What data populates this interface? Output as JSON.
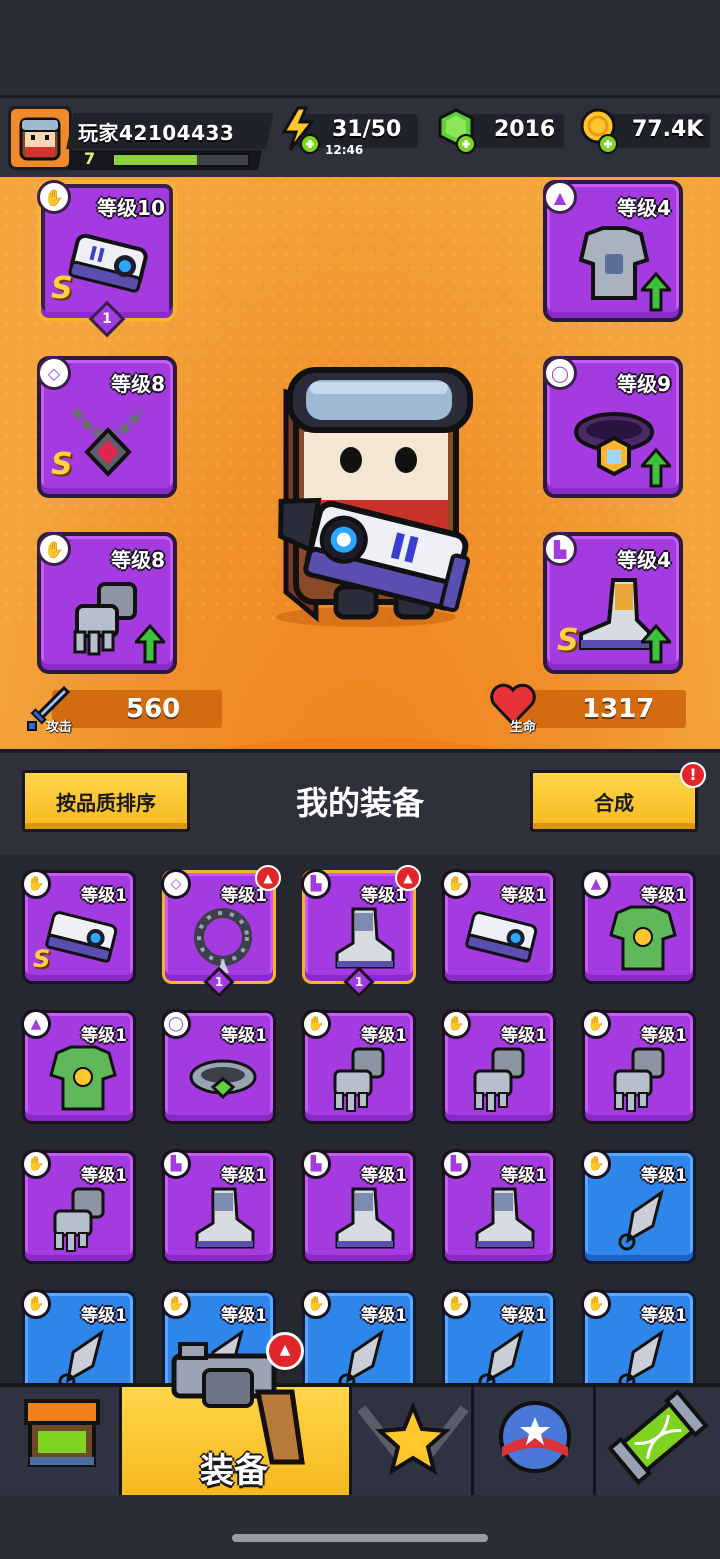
{
  "player": {
    "name": "玩家42104433",
    "level": "7",
    "xp_fraction": 0.62
  },
  "resources": {
    "energy": {
      "value": "31/50",
      "timer": "12:46",
      "icon": "lightning-icon"
    },
    "gems": {
      "value": "2016",
      "icon": "green-gem-icon"
    },
    "coins": {
      "value": "77.4K",
      "icon": "gold-coin-icon"
    }
  },
  "equipped": {
    "weapon": {
      "level": "等级10",
      "rank": "S",
      "stars": "1"
    },
    "armor": {
      "level": "等级4"
    },
    "necklace": {
      "level": "等级8",
      "rank": "S"
    },
    "ring": {
      "level": "等级9"
    },
    "gloves": {
      "level": "等级8"
    },
    "boots": {
      "level": "等级4",
      "rank": "S"
    }
  },
  "stats": {
    "attack": {
      "label": "攻击",
      "value": "560"
    },
    "hp": {
      "label": "生命",
      "value": "1317"
    }
  },
  "toolbar": {
    "sort_label": "按品质排序",
    "title": "我的装备",
    "merge_label": "合成",
    "merge_alert": "!"
  },
  "inventory": [
    {
      "type": "weapon",
      "level": "等级1",
      "rarity": "purple",
      "rank": "S"
    },
    {
      "type": "necklace",
      "level": "等级1",
      "rarity": "purple",
      "star": "1",
      "gold": true,
      "equipped": true
    },
    {
      "type": "boots",
      "level": "等级1",
      "rarity": "purple",
      "star": "1",
      "gold": true,
      "equipped": true
    },
    {
      "type": "weapon",
      "level": "等级1",
      "rarity": "purple"
    },
    {
      "type": "armor",
      "level": "等级1",
      "rarity": "purple"
    },
    {
      "type": "armor",
      "level": "等级1",
      "rarity": "purple"
    },
    {
      "type": "ring",
      "level": "等级1",
      "rarity": "purple"
    },
    {
      "type": "gloves",
      "level": "等级1",
      "rarity": "purple"
    },
    {
      "type": "gloves",
      "level": "等级1",
      "rarity": "purple"
    },
    {
      "type": "gloves",
      "level": "等级1",
      "rarity": "purple"
    },
    {
      "type": "gloves",
      "level": "等级1",
      "rarity": "purple"
    },
    {
      "type": "boots",
      "level": "等级1",
      "rarity": "purple"
    },
    {
      "type": "boots",
      "level": "等级1",
      "rarity": "purple"
    },
    {
      "type": "boots",
      "level": "等级1",
      "rarity": "purple"
    },
    {
      "type": "weapon",
      "level": "等级1",
      "rarity": "blue"
    },
    {
      "type": "weapon",
      "level": "等级1",
      "rarity": "blue"
    },
    {
      "type": "weapon",
      "level": "等级1",
      "rarity": "blue"
    },
    {
      "type": "weapon",
      "level": "等级1",
      "rarity": "blue"
    },
    {
      "type": "weapon",
      "level": "等级1",
      "rarity": "blue"
    },
    {
      "type": "weapon",
      "level": "等级1",
      "rarity": "blue"
    }
  ],
  "nav": {
    "shop": {
      "icon": "shop-icon"
    },
    "equipment": {
      "label": "装备",
      "icon": "revolver-icon"
    },
    "battle": {
      "icon": "crossed-swords-star-icon"
    },
    "talents": {
      "icon": "star-ball-icon"
    },
    "lab": {
      "icon": "dna-capsule-icon"
    }
  },
  "colors": {
    "purple": "#a33be0",
    "blue": "#2e86ea",
    "gold": "#f7b32b",
    "orange": "#f0902a"
  }
}
